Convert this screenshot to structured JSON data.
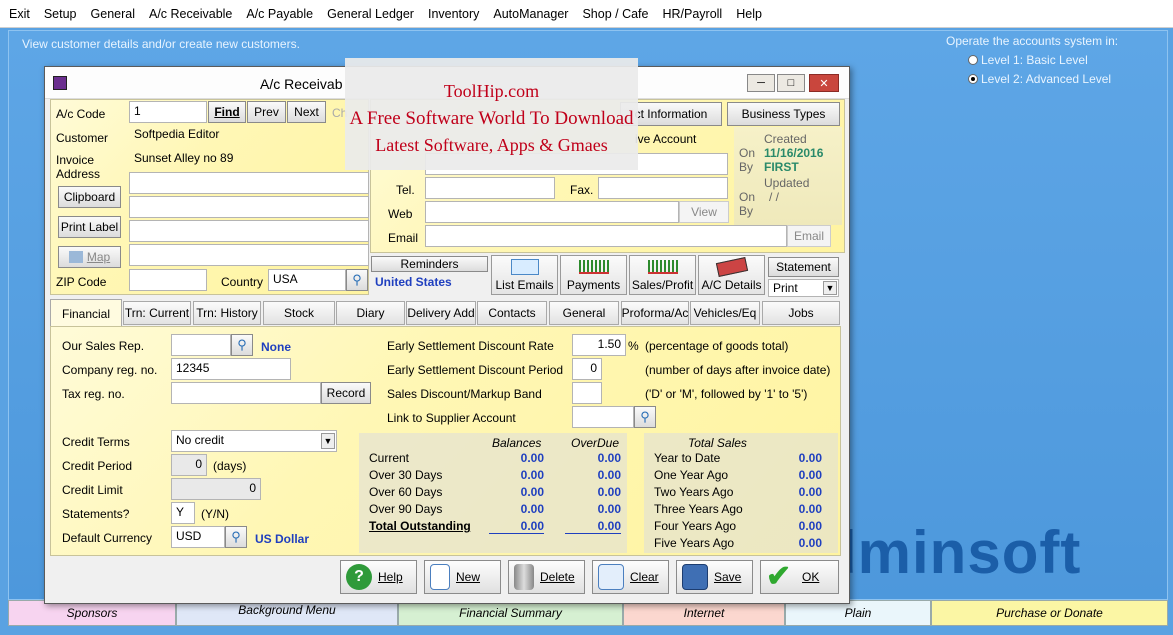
{
  "menu": [
    "Exit",
    "Setup",
    "General",
    "A/c Receivable",
    "A/c Payable",
    "General Ledger",
    "Inventory",
    "AutoManager",
    "Shop / Cafe",
    "HR/Payroll",
    "Help"
  ],
  "desktop": {
    "hint": "View customer details and/or create new customers.",
    "operate_label": "Operate the accounts system in:",
    "level1": "Level 1: Basic Level",
    "level2": "Level 2: Advanced Level",
    "brand": "dminsoft"
  },
  "bottom_tabs": [
    "Sponsors",
    "Background Menu",
    "Financial Summary",
    "Internet",
    "Plain",
    "Purchase or Donate"
  ],
  "window": {
    "title": "A/c Receivab",
    "btn_min": "─",
    "btn_max": "□",
    "btn_close": "✕"
  },
  "top": {
    "ac_code_label": "A/c Code",
    "ac_code": "1",
    "find": "Find",
    "prev": "Prev",
    "next": "Next",
    "ch": "Ch",
    "customer_label": "Customer",
    "customer": "Softpedia Editor",
    "invoice_label": "Invoice Address",
    "address1": "Sunset Alley no 89",
    "clipboard": "Clipboard",
    "print_label": "Print Label",
    "map": "Map",
    "zip_label": "ZIP Code",
    "country_label": "Country",
    "country": "USA",
    "country_name": "United States"
  },
  "right_top": {
    "contact_info_tab": "ct Information",
    "business_types_tab": "Business Types",
    "ive_account": "ive Account",
    "tel_label": "Tel.",
    "fax_label": "Fax.",
    "web_label": "Web",
    "email_label": "Email",
    "view": "View",
    "email_btn": "Email",
    "created": "Created",
    "on": "On",
    "created_date": "11/16/2016",
    "by": "By",
    "created_by": "FIRST",
    "updated": "Updated",
    "on2": "On",
    "updated_date": "/  /",
    "by2": "By"
  },
  "actions_row": {
    "reminders": "Reminders",
    "list_emails": "List Emails",
    "payments": "Payments",
    "sales_profit": "Sales/Profit",
    "ac_details": "A/C Details",
    "statement": "Statement",
    "print": "Print"
  },
  "tabs": [
    "Financial",
    "Trn: Current",
    "Trn: History",
    "Stock",
    "Diary",
    "Delivery Add",
    "Contacts",
    "General",
    "Proforma/Ac",
    "Vehicles/Eq",
    "Jobs"
  ],
  "financial": {
    "sales_rep_label": "Our Sales Rep.",
    "sales_rep_val": "None",
    "company_reg_label": "Company reg. no.",
    "company_reg": "12345",
    "tax_reg_label": "Tax reg. no.",
    "record": "Record",
    "credit_terms_label": "Credit Terms",
    "credit_terms": "No credit",
    "credit_period_label": "Credit Period",
    "credit_period": "0",
    "days": "(days)",
    "credit_limit_label": "Credit Limit",
    "credit_limit": "0",
    "statements_label": "Statements?",
    "statements": "Y",
    "yn": "(Y/N)",
    "currency_label": "Default Currency",
    "currency": "USD",
    "currency_name": "US Dollar"
  },
  "settlement": {
    "esd_rate_label": "Early Settlement Discount Rate",
    "esd_rate": "1.50",
    "pct": "%",
    "esd_rate_note": "(percentage of goods total)",
    "esd_period_label": "Early Settlement Discount Period",
    "esd_period": "0",
    "esd_period_note": "(number of days after invoice date)",
    "band_label": "Sales Discount/Markup Band",
    "band_note": "('D' or 'M', followed by '1' to '5')",
    "supplier_label": "Link to Supplier Account"
  },
  "balances": {
    "h_bal": "Balances",
    "h_over": "OverDue",
    "rows": [
      {
        "label": "Current",
        "bal": "0.00",
        "over": "0.00"
      },
      {
        "label": "Over 30 Days",
        "bal": "0.00",
        "over": "0.00"
      },
      {
        "label": "Over 60 Days",
        "bal": "0.00",
        "over": "0.00"
      },
      {
        "label": "Over 90 Days",
        "bal": "0.00",
        "over": "0.00"
      },
      {
        "label": "Total Outstanding",
        "bal": "0.00",
        "over": "0.00"
      }
    ]
  },
  "total_sales": {
    "header": "Total Sales",
    "rows": [
      {
        "label": "Year to Date",
        "val": "0.00"
      },
      {
        "label": "One Year Ago",
        "val": "0.00"
      },
      {
        "label": "Two Years Ago",
        "val": "0.00"
      },
      {
        "label": "Three Years Ago",
        "val": "0.00"
      },
      {
        "label": "Four Years Ago",
        "val": "0.00"
      },
      {
        "label": "Five Years Ago",
        "val": "0.00"
      }
    ]
  },
  "buttons": {
    "help": "Help",
    "new": "New",
    "delete": "Delete",
    "clear": "Clear",
    "save": "Save",
    "ok": "OK"
  },
  "watermark": {
    "line1": "ToolHip.com",
    "line2": "A Free Software World To Download",
    "line3": "Latest Software, Apps & Gmaes"
  }
}
